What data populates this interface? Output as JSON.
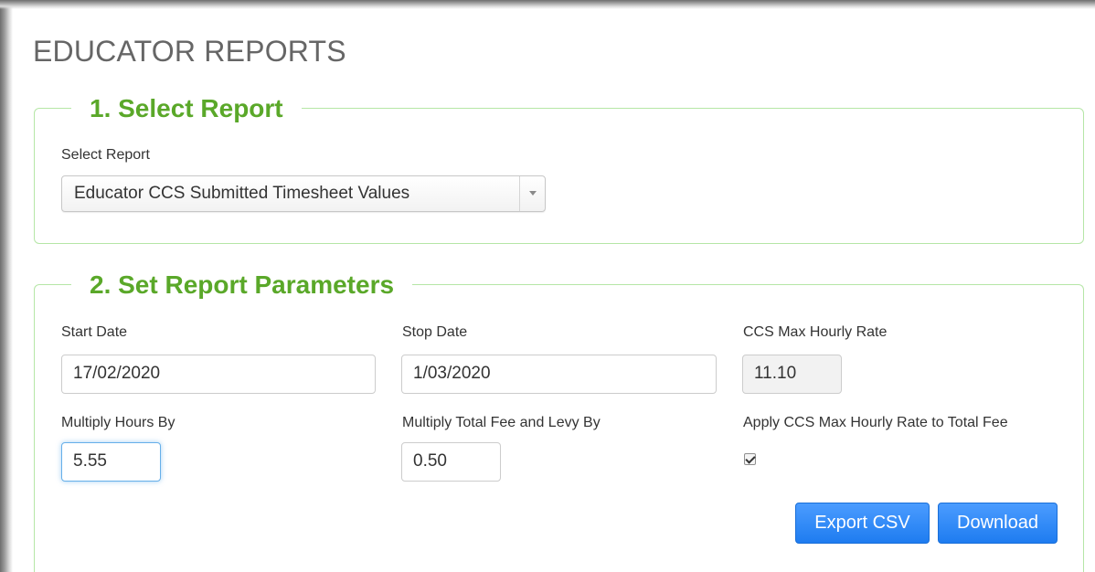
{
  "page": {
    "title": "EDUCATOR REPORTS"
  },
  "section_select": {
    "legend": "1. Select Report",
    "select_label": "Select Report",
    "selected_report": "Educator CCS Submitted Timesheet Values"
  },
  "section_params": {
    "legend": "2. Set Report Parameters",
    "start_date_label": "Start Date",
    "start_date_value": "17/02/2020",
    "stop_date_label": "Stop Date",
    "stop_date_value": "1/03/2020",
    "ccs_rate_label": "CCS Max Hourly Rate",
    "ccs_rate_value": "11.10",
    "multiply_hours_label": "Multiply Hours By",
    "multiply_hours_value": "5.55",
    "multiply_fee_label": "Multiply Total Fee and Levy By",
    "multiply_fee_value": "0.50",
    "apply_rate_label": "Apply CCS Max Hourly Rate to Total Fee",
    "apply_rate_checked": true
  },
  "actions": {
    "export_csv_label": "Export CSV",
    "download_label": "Download"
  },
  "colors": {
    "legend_green": "#5aa829",
    "panel_border": "#b5e6a6",
    "button_blue": "#1e7cf0",
    "focus_blue": "#66afe9"
  },
  "icons": {
    "select_dropdown": "chevron-down-icon",
    "checkbox": "checkmark-icon"
  }
}
